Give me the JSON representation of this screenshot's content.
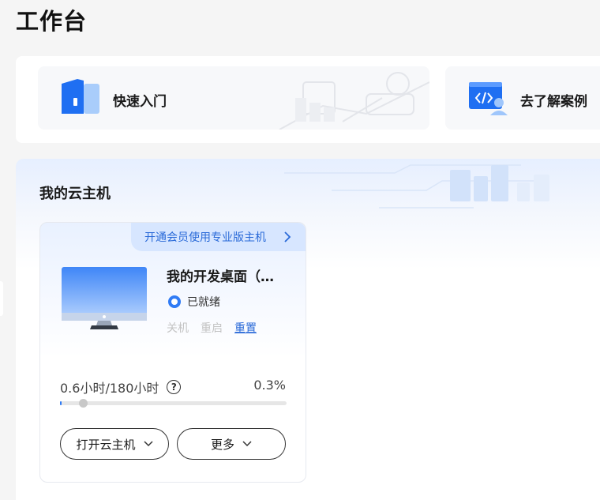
{
  "page": {
    "title": "工作台"
  },
  "quick_entries": [
    {
      "label": "快速入门",
      "icon": "door-entry-icon"
    },
    {
      "label": "去了解案例",
      "icon": "code-window-user-icon"
    }
  ],
  "cloud_hosts": {
    "section_title": "我的云主机",
    "card": {
      "promo_label": "开通会员使用专业版主机",
      "name": "我的开发桌面（…",
      "status": "已就绪",
      "actions": {
        "shutdown": "关机",
        "restart": "重启",
        "reset": "重置"
      },
      "usage_label": "0.6小时/180小时",
      "usage_help": "?",
      "usage_percent_text": "0.3%",
      "usage_percent": 0.3,
      "buttons": {
        "open": "打开云主机",
        "more": "更多"
      }
    }
  },
  "colors": {
    "accent": "#2f7bf5",
    "link": "#2a6ad8",
    "promo_bg": "#d7e6ff"
  }
}
